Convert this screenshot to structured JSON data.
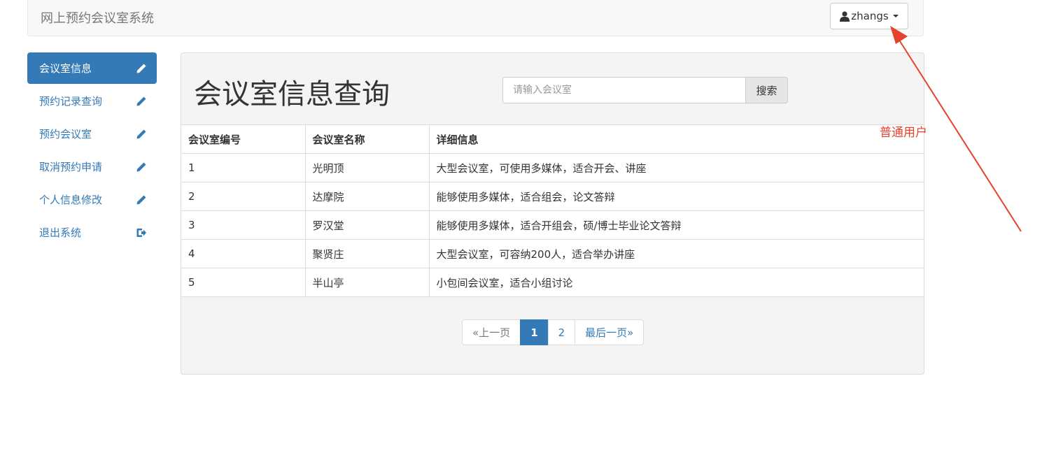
{
  "navbar": {
    "brand": "网上预约会议室系统",
    "user": "zhangs"
  },
  "sidebar": {
    "items": [
      {
        "label": "会议室信息",
        "icon": "pencil-icon",
        "active": true
      },
      {
        "label": "预约记录查询",
        "icon": "pencil-icon",
        "active": false
      },
      {
        "label": "预约会议室",
        "icon": "pencil-icon",
        "active": false
      },
      {
        "label": "取消预约申请",
        "icon": "pencil-icon",
        "active": false
      },
      {
        "label": "个人信息修改",
        "icon": "pencil-icon",
        "active": false
      },
      {
        "label": "退出系统",
        "icon": "logout-icon",
        "active": false
      }
    ]
  },
  "main": {
    "title": "会议室信息查询",
    "search": {
      "placeholder": "请输入会议室",
      "value": "",
      "button_label": "搜索"
    },
    "table": {
      "columns": [
        "会议室编号",
        "会议室名称",
        "详细信息"
      ],
      "rows": [
        [
          "1",
          "光明顶",
          "大型会议室，可使用多媒体，适合开会、讲座"
        ],
        [
          "2",
          "达摩院",
          "能够使用多媒体，适合组会，论文答辩"
        ],
        [
          "3",
          "罗汉堂",
          "能够使用多媒体，适合开组会，硕/博士毕业论文答辩"
        ],
        [
          "4",
          "聚贤庄",
          "大型会议室，可容纳200人，适合举办讲座"
        ],
        [
          "5",
          "半山亭",
          "小包间会议室，适合小组讨论"
        ]
      ]
    },
    "pagination": {
      "prev": "«上一页",
      "pages": [
        "1",
        "2"
      ],
      "current": "1",
      "last": "最后一页»"
    }
  },
  "annotation": {
    "label": "普通用户",
    "color": "#e8412e"
  },
  "colors": {
    "primary": "#337ab7",
    "annotation": "#e8412e"
  }
}
